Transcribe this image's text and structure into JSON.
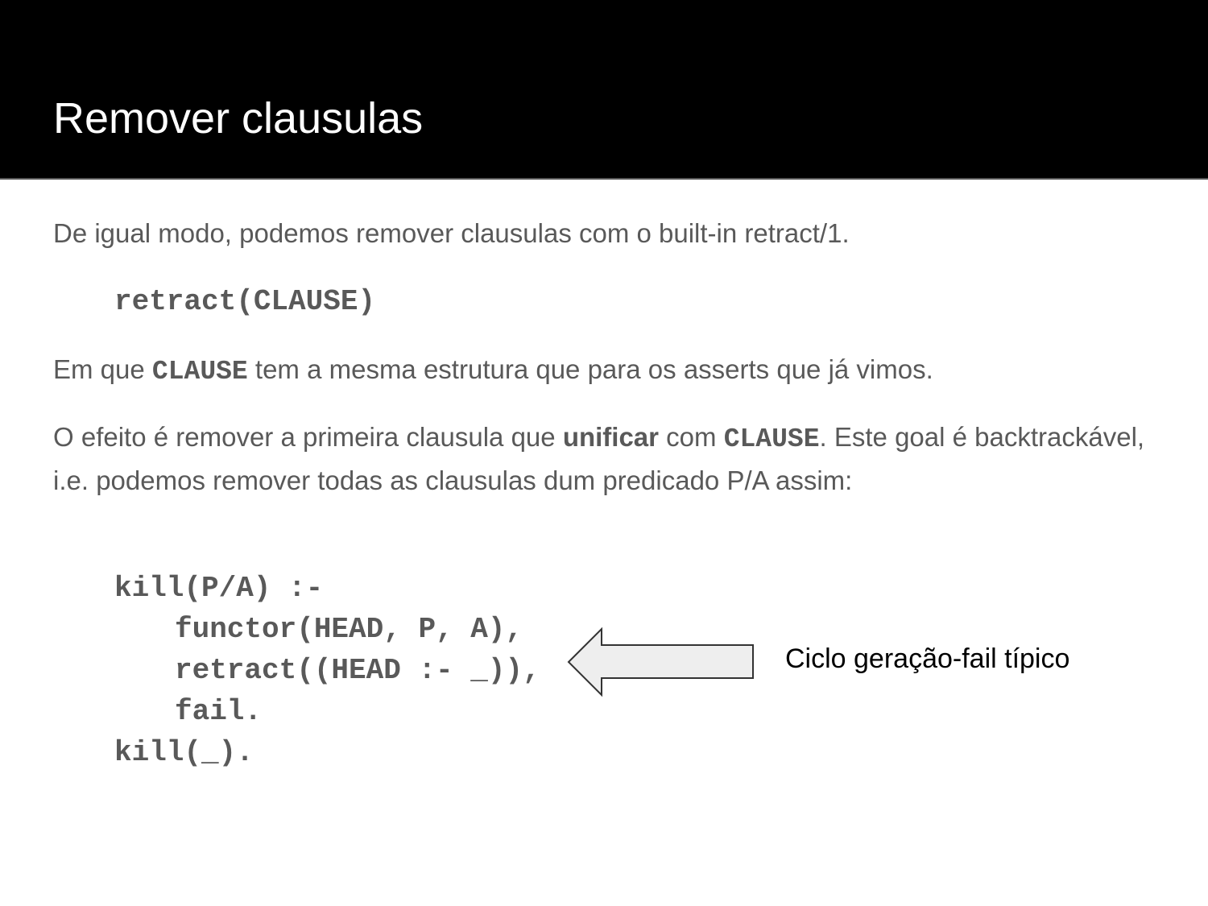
{
  "slide": {
    "title": "Remover clausulas",
    "intro": "De igual modo, podemos remover clausulas com o built-in retract/1.",
    "syntax": "retract(CLAUSE)",
    "line2": {
      "before": "Em que ",
      "keyword": "CLAUSE",
      "after": " tem a mesma estrutura que para os asserts que já vimos."
    },
    "line3": {
      "t1": "O efeito é remover a primeira clausula que ",
      "bold1": "unificar",
      "t2": " com ",
      "keyword": "CLAUSE",
      "t3": ". Este goal é backtrackável, i.e. podemos remover todas as clausulas dum predicado P/A assim:"
    },
    "code": [
      "kill(P/A) :-",
      "functor(HEAD, P, A),",
      "retract((HEAD :- _)),",
      "fail.",
      "kill(_)."
    ],
    "annotation": "Ciclo geração-fail típico"
  },
  "colors": {
    "header_bg": "#000000",
    "title_text": "#ffffff",
    "body_text": "#595959",
    "arrow_fill": "#eeeeee",
    "arrow_stroke": "#333333"
  }
}
